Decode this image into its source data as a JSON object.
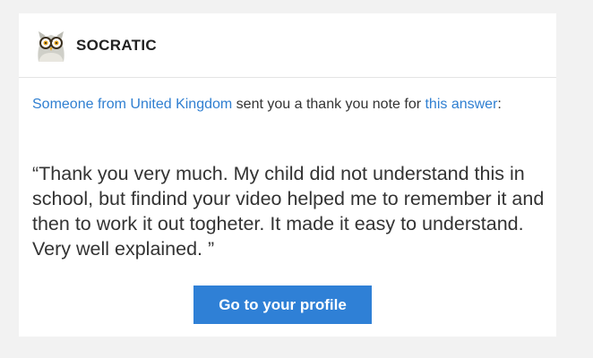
{
  "brand": {
    "name": "SOCRATIC",
    "logo_icon": "owl-logo-icon"
  },
  "message": {
    "sender_link": "Someone from United Kingdom",
    "middle_text": " sent you a thank you note for ",
    "answer_link": "this answer",
    "end_punctuation": ":",
    "quote": "“Thank you very much. My child did not understand this in school, but findind your video helped me to remember it and then to work it out togheter. It made it easy to understand. Very well explained. ”"
  },
  "cta": {
    "label": "Go to your profile"
  },
  "colors": {
    "link": "#2f7fd1",
    "button": "#2f80d6",
    "background": "#f2f2f2"
  }
}
